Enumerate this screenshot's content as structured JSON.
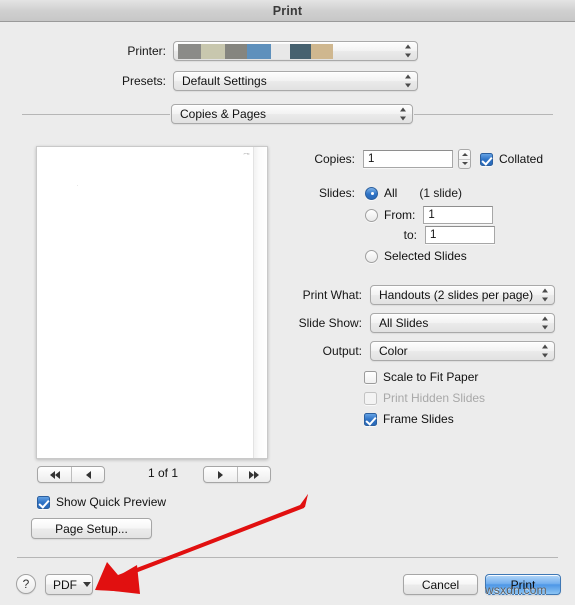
{
  "window": {
    "title": "Print"
  },
  "printer": {
    "label": "Printer:",
    "value": "",
    "redacted": true,
    "redaction_colors": [
      "#8b8b88",
      "#c8c7ae",
      "#85857f",
      "#5e90bc",
      "#e8e8e8",
      "#46616f",
      "#cfb78f"
    ]
  },
  "presets": {
    "label": "Presets:",
    "value": "Default Settings"
  },
  "pane": {
    "value": "Copies & Pages"
  },
  "copies": {
    "label": "Copies:",
    "value": "1",
    "placeholder": "1",
    "collated_label": "Collated",
    "collated_checked": true
  },
  "slides": {
    "label": "Slides:",
    "all_label": "All",
    "all_selected": true,
    "count_note": "(1 slide)",
    "from_label": "From:",
    "from_value": "1",
    "to_label": "to:",
    "to_value": "1",
    "selected_label": "Selected Slides",
    "range_selected": false,
    "selected_slides_selected": false
  },
  "print_what": {
    "label": "Print What:",
    "value": "Handouts (2 slides per page)"
  },
  "slide_show": {
    "label": "Slide Show:",
    "value": "All Slides"
  },
  "output": {
    "label": "Output:",
    "value": "Color"
  },
  "options": [
    {
      "label": "Scale to Fit Paper",
      "checked": false,
      "disabled": false
    },
    {
      "label": "Print Hidden Slides",
      "checked": false,
      "disabled": true
    },
    {
      "label": "Frame Slides",
      "checked": true,
      "disabled": false
    }
  ],
  "preview": {
    "page_indicator": "1 of 1",
    "first_label": "first-page",
    "prev_label": "previous-page",
    "next_label": "next-page",
    "last_label": "last-page"
  },
  "quick_preview": {
    "label": "Show Quick Preview",
    "checked": true
  },
  "page_setup": {
    "label": "Page Setup..."
  },
  "footer": {
    "help_label": "?",
    "pdf_label": "PDF",
    "cancel_label": "Cancel",
    "print_label": "Print"
  },
  "annotation": {
    "arrow_color": "#e11010",
    "arrow_points_to": "pdf-button"
  },
  "watermark": {
    "text": "wsxdn.com"
  }
}
